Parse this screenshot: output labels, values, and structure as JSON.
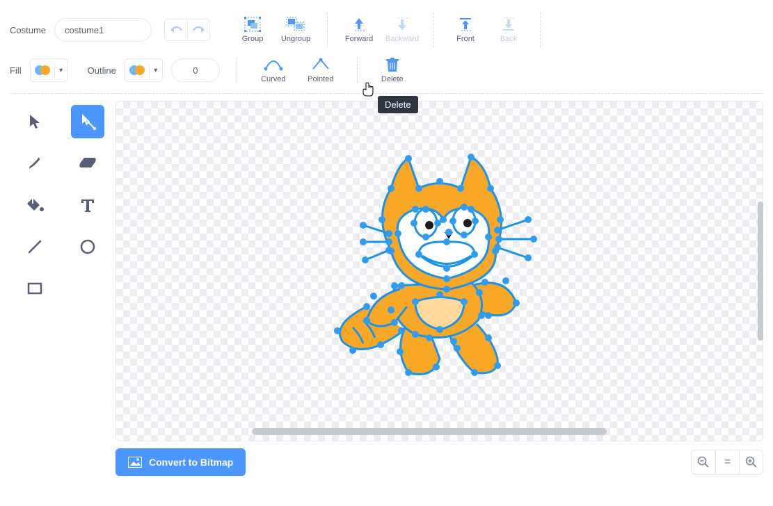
{
  "header": {
    "costume_label": "Costume",
    "costume_name": "costume1",
    "actions": {
      "group": "Group",
      "ungroup": "Ungroup",
      "forward": "Forward",
      "backward": "Backward",
      "front": "Front",
      "back": "Back"
    }
  },
  "header2": {
    "fill_label": "Fill",
    "outline_label": "Outline",
    "fill_color": "#f9a726",
    "outline_color": "#f9a726",
    "outline_width": "0",
    "curved": "Curved",
    "pointed": "Pointed",
    "delete": "Delete"
  },
  "tooltip": "Delete",
  "bottom": {
    "convert_label": "Convert to Bitmap",
    "zoom_reset": "="
  }
}
